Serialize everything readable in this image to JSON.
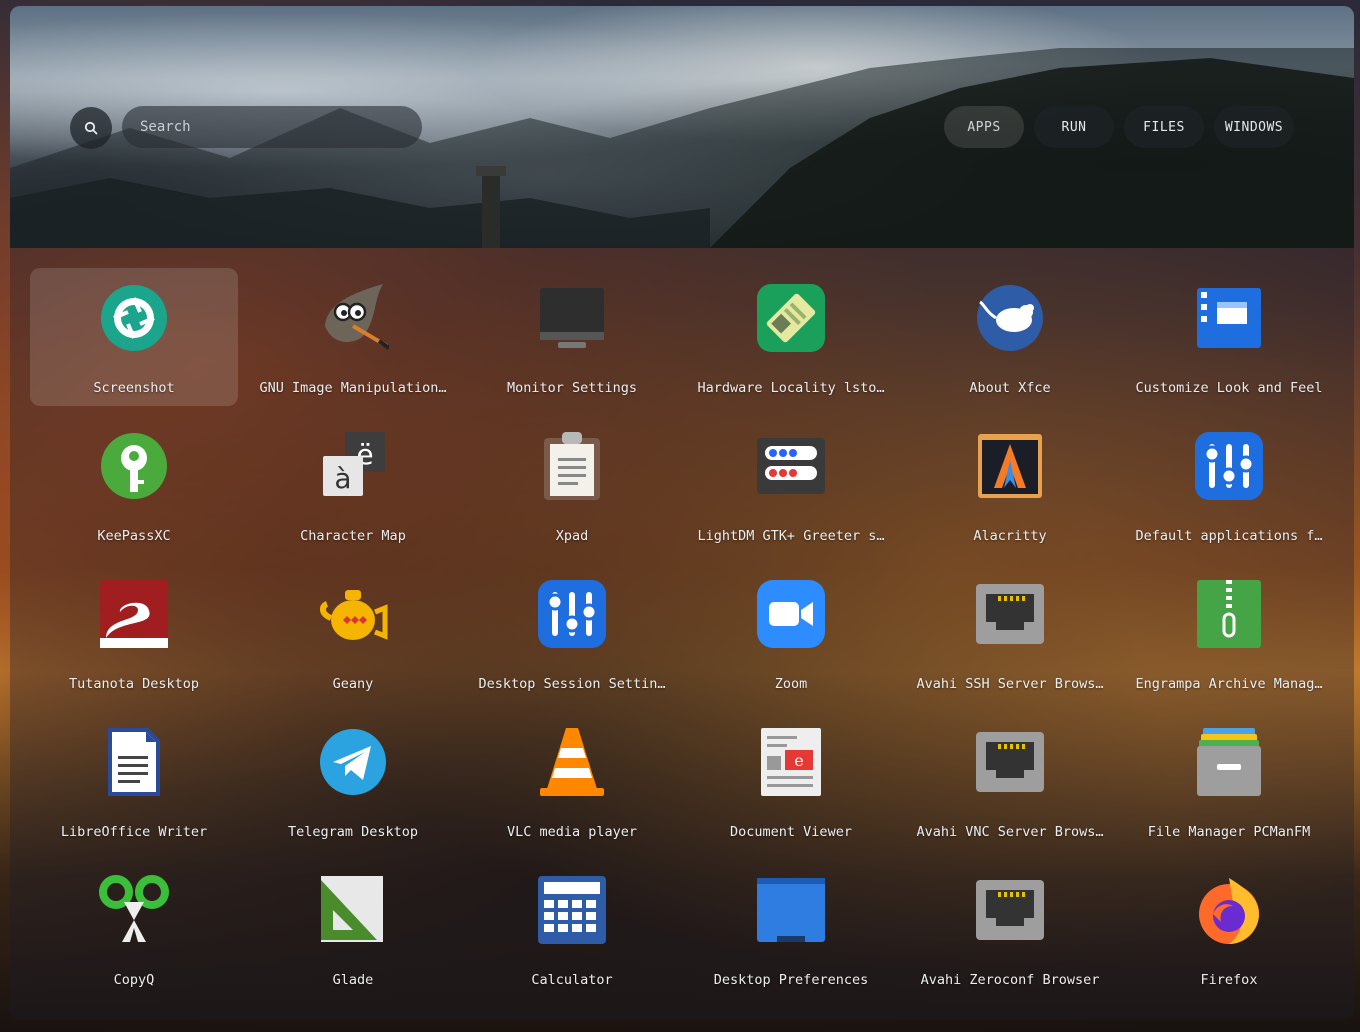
{
  "search": {
    "placeholder": "Search",
    "value": ""
  },
  "tabs": [
    {
      "label": "APPS",
      "active": true
    },
    {
      "label": "RUN",
      "active": false
    },
    {
      "label": "FILES",
      "active": false
    },
    {
      "label": "WINDOWS",
      "active": false
    }
  ],
  "apps": [
    {
      "label": "Screenshot",
      "icon": "screenshot-icon",
      "selected": true
    },
    {
      "label": "GNU Image Manipulation…",
      "icon": "gimp-icon"
    },
    {
      "label": "Monitor Settings",
      "icon": "monitor-icon"
    },
    {
      "label": "Hardware Locality lsto…",
      "icon": "hardware-locality-icon"
    },
    {
      "label": "About Xfce",
      "icon": "xfce-mouse-icon"
    },
    {
      "label": "Customize Look and Feel",
      "icon": "appearance-icon"
    },
    {
      "label": "KeePassXC",
      "icon": "keepassxc-icon"
    },
    {
      "label": "Character Map",
      "icon": "character-map-icon"
    },
    {
      "label": "Xpad",
      "icon": "clipboard-icon"
    },
    {
      "label": "LightDM GTK+ Greeter s…",
      "icon": "greeter-settings-icon"
    },
    {
      "label": "Alacritty",
      "icon": "alacritty-icon"
    },
    {
      "label": "Default applications f…",
      "icon": "sliders-icon"
    },
    {
      "label": "Tutanota Desktop",
      "icon": "tutanota-icon"
    },
    {
      "label": "Geany",
      "icon": "teapot-icon"
    },
    {
      "label": "Desktop Session Settin…",
      "icon": "sliders-icon"
    },
    {
      "label": "Zoom",
      "icon": "video-camera-icon"
    },
    {
      "label": "Avahi SSH Server Brows…",
      "icon": "network-port-icon"
    },
    {
      "label": "Engrampa Archive Manag…",
      "icon": "archive-zipper-icon"
    },
    {
      "label": "LibreOffice Writer",
      "icon": "writer-document-icon"
    },
    {
      "label": "Telegram Desktop",
      "icon": "telegram-icon"
    },
    {
      "label": "VLC media player",
      "icon": "traffic-cone-icon"
    },
    {
      "label": "Document Viewer",
      "icon": "document-viewer-icon"
    },
    {
      "label": "Avahi VNC Server Brows…",
      "icon": "network-port-icon"
    },
    {
      "label": "File Manager PCManFM",
      "icon": "file-cabinet-icon"
    },
    {
      "label": "CopyQ",
      "icon": "scissors-icon"
    },
    {
      "label": "Glade",
      "icon": "set-square-icon"
    },
    {
      "label": "Calculator",
      "icon": "calculator-icon"
    },
    {
      "label": "Desktop Preferences",
      "icon": "desktop-window-icon"
    },
    {
      "label": "Avahi Zeroconf Browser",
      "icon": "network-port-icon"
    },
    {
      "label": "Firefox",
      "icon": "firefox-icon"
    }
  ]
}
